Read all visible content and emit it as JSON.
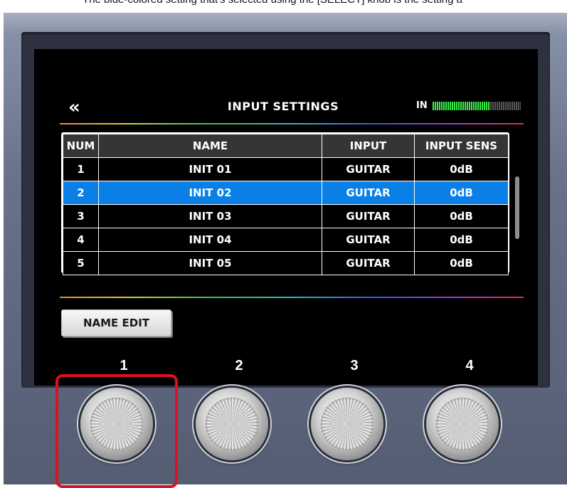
{
  "caption": "The blue-colored setting that's selected using the [SELECT] knob is the setting a",
  "screen": {
    "title": "INPUT SETTINGS",
    "back_icon": "double-chevron-left",
    "meter": {
      "label": "IN",
      "level": 0.65,
      "color": "#3cf24a"
    },
    "table": {
      "headers": [
        "NUM",
        "NAME",
        "INPUT",
        "INPUT SENS"
      ],
      "rows": [
        [
          "1",
          "INIT 01",
          "GUITAR",
          "0dB"
        ],
        [
          "2",
          "INIT 02",
          "GUITAR",
          "0dB"
        ],
        [
          "3",
          "INIT 03",
          "GUITAR",
          "0dB"
        ],
        [
          "4",
          "INIT 04",
          "GUITAR",
          "0dB"
        ],
        [
          "5",
          "INIT 05",
          "GUITAR",
          "0dB"
        ]
      ],
      "selected_row": 1,
      "selected_color": "#0a7fe6"
    },
    "button": {
      "name_edit": "NAME EDIT"
    },
    "knob_numbers": [
      "1",
      "2",
      "3",
      "4"
    ]
  },
  "highlight_color": "#e0101e"
}
